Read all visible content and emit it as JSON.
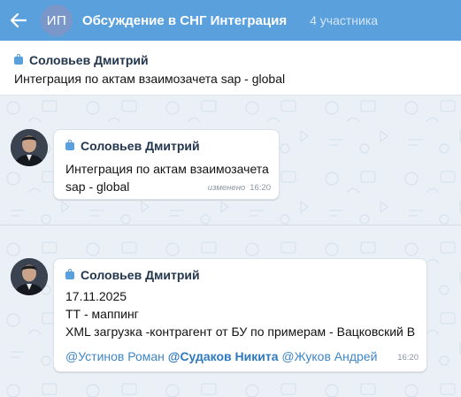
{
  "header": {
    "back_icon": "arrow-left-icon",
    "avatar_initials": "ИП",
    "title": "Обсуждение в СНГ Интеграция",
    "participants": "4 участника",
    "color": "#5aa0dd"
  },
  "pinned": {
    "author": "Соловьев Дмитрий",
    "text": "Интеграция по актам взаимозачета sap - global",
    "icon": "briefcase-icon"
  },
  "messages": [
    {
      "author": "Соловьев Дмитрий",
      "lines": [
        "Интеграция по актам взаимозачета",
        "sap - global"
      ],
      "edited": "изменено",
      "time": "16:20"
    },
    {
      "author": "Соловьев Дмитрий",
      "lines": [
        "17.11.2025",
        "ТТ - маппинг",
        "XML загрузка -контрагент от БУ по примерам - Вацковский В"
      ],
      "mentions": [
        "@Устинов Роман",
        "@Судаков Никита",
        "@Жуков Андрей"
      ],
      "time": "16:20"
    }
  ]
}
